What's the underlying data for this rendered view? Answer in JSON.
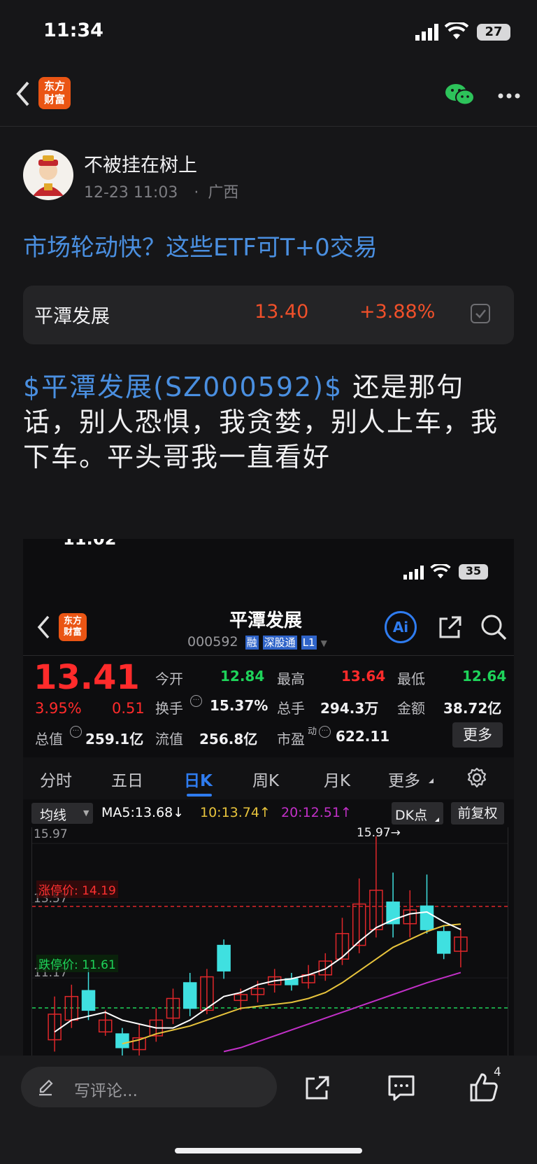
{
  "status": {
    "time": "11:34",
    "battery": "27"
  },
  "header": {
    "logo_line1": "东方",
    "logo_line2": "财富"
  },
  "post": {
    "author": "不被挂在树上",
    "meta_time": "12-23 11:03",
    "meta_sep": "·",
    "meta_region": "广西",
    "link_title": "市场轮动快？这些ETF可T+0交易",
    "stock_card": {
      "name": "平潭发展",
      "price": "13.40",
      "change": "+3.88%"
    },
    "body_stock": "$平潭发展(SZ000592)$",
    "body_text": " 还是那句话，别人恐惧，我贪婪，别人上车，我下车。平头哥我一直看好"
  },
  "shot": {
    "status_time": "11:02",
    "battery": "35",
    "title": "平潭发展",
    "code": "000592",
    "badges": [
      "融",
      "深股通",
      "L1"
    ],
    "ai": "Ai",
    "price": "13.41",
    "change_pct": "3.95%",
    "change_abs": "0.51",
    "quote": {
      "open_label": "今开",
      "open": "12.84",
      "high_label": "最高",
      "high": "13.64",
      "low_label": "最低",
      "low": "12.64",
      "turnover_label": "换手",
      "turnover": "15.37%",
      "volume_label": "总手",
      "volume": "294.3万",
      "amount_label": "金额",
      "amount": "38.72亿",
      "mcap_label": "总值",
      "mcap": "259.1亿",
      "float_label": "流值",
      "float": "256.8亿",
      "pe_label": "市盈",
      "pe_sup": "动",
      "pe": "622.11",
      "more": "更多"
    },
    "tabs": [
      "分时",
      "五日",
      "日K",
      "周K",
      "月K",
      "更多"
    ],
    "active_tab": "日K",
    "ma_select": "均线",
    "ma5": "MA5:13.68↓",
    "ma10": "10:13.74↑",
    "ma20": "20:12.51↑",
    "dk": "DK点",
    "adjust": "前复权",
    "axis_top": "15.97",
    "axis_mid": "13.57",
    "axis_low": "11.17",
    "max_marker": "15.97→",
    "limit_up": "涨停价: 14.19",
    "limit_down": "跌停价: 11.61",
    "colors": {
      "up": "#e0272a",
      "down": "#3fe0e0",
      "ma5": "#ffffff",
      "ma10": "#e7c33c",
      "ma20": "#c230c8"
    }
  },
  "chart_data": {
    "type": "candlestick",
    "title": "",
    "ylim": [
      10.4,
      16.2
    ],
    "candles": [
      {
        "o": 10.8,
        "c": 11.45,
        "h": 11.9,
        "l": 10.5
      },
      {
        "o": 11.3,
        "c": 11.9,
        "h": 12.2,
        "l": 11.1
      },
      {
        "o": 12.05,
        "c": 11.55,
        "h": 12.65,
        "l": 11.3
      },
      {
        "o": 11.0,
        "c": 11.3,
        "h": 11.55,
        "l": 10.9
      },
      {
        "o": 10.95,
        "c": 10.6,
        "h": 11.1,
        "l": 10.4
      },
      {
        "o": 10.55,
        "c": 10.85,
        "h": 11.2,
        "l": 10.4
      },
      {
        "o": 10.9,
        "c": 11.3,
        "h": 11.6,
        "l": 10.75
      },
      {
        "o": 11.35,
        "c": 11.85,
        "h": 12.1,
        "l": 11.2
      },
      {
        "o": 12.25,
        "c": 11.6,
        "h": 12.5,
        "l": 11.4
      },
      {
        "o": 11.55,
        "c": 12.4,
        "h": 12.6,
        "l": 11.45
      },
      {
        "o": 13.2,
        "c": 12.55,
        "h": 13.35,
        "l": 12.35
      },
      {
        "o": 11.8,
        "c": 11.95,
        "h": 12.1,
        "l": 11.55
      },
      {
        "o": 11.95,
        "c": 12.1,
        "h": 12.3,
        "l": 11.75
      },
      {
        "o": 12.2,
        "c": 12.4,
        "h": 12.6,
        "l": 12.0
      },
      {
        "o": 12.35,
        "c": 12.2,
        "h": 12.5,
        "l": 12.05
      },
      {
        "o": 12.25,
        "c": 12.45,
        "h": 12.7,
        "l": 12.1
      },
      {
        "o": 12.45,
        "c": 12.8,
        "h": 13.0,
        "l": 12.3
      },
      {
        "o": 12.85,
        "c": 13.5,
        "h": 13.9,
        "l": 12.7
      },
      {
        "o": 13.2,
        "c": 14.25,
        "h": 14.9,
        "l": 13.0
      },
      {
        "o": 13.6,
        "c": 14.6,
        "h": 15.97,
        "l": 13.4
      },
      {
        "o": 14.3,
        "c": 13.75,
        "h": 15.05,
        "l": 13.4
      },
      {
        "o": 13.75,
        "c": 14.1,
        "h": 14.6,
        "l": 13.4
      },
      {
        "o": 14.2,
        "c": 13.6,
        "h": 15.0,
        "l": 13.5
      },
      {
        "o": 13.55,
        "c": 13.0,
        "h": 13.7,
        "l": 12.85
      },
      {
        "o": 13.05,
        "c": 13.41,
        "h": 13.64,
        "l": 12.64
      }
    ],
    "ma5": [
      11.0,
      11.3,
      11.4,
      11.5,
      11.3,
      11.2,
      11.1,
      11.1,
      11.3,
      11.6,
      11.9,
      12.0,
      12.2,
      12.3,
      12.35,
      12.45,
      12.6,
      12.9,
      13.3,
      13.65,
      13.85,
      14.0,
      14.05,
      13.8,
      13.6
    ],
    "ma10": [
      null,
      null,
      null,
      null,
      10.7,
      10.8,
      10.95,
      11.05,
      11.15,
      11.3,
      11.45,
      11.6,
      11.65,
      11.7,
      11.75,
      11.85,
      12.0,
      12.25,
      12.55,
      12.85,
      13.15,
      13.35,
      13.55,
      13.7,
      13.74
    ],
    "ma20": [
      null,
      null,
      null,
      null,
      null,
      null,
      null,
      null,
      null,
      null,
      10.5,
      10.6,
      10.75,
      10.9,
      11.05,
      11.2,
      11.35,
      11.5,
      11.65,
      11.8,
      11.95,
      12.1,
      12.25,
      12.38,
      12.51
    ],
    "limit_up": 14.19,
    "limit_down": 11.61
  },
  "bottom": {
    "comment_placeholder": "写评论...",
    "like_count": "4"
  }
}
